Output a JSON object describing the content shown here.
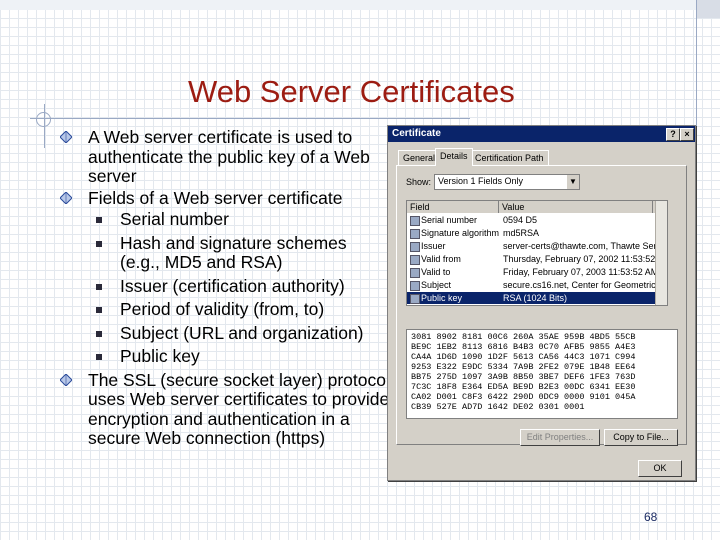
{
  "slide": {
    "title": "Web Server Certificates",
    "page_number": "68",
    "bullets": [
      {
        "text": "A Web server certificate is used to authenticate the public key of a Web server"
      },
      {
        "text": "Fields of a Web server certificate",
        "subitems": [
          "Serial number",
          "Hash and signature schemes (e.g., MD5 and RSA)",
          "Issuer (certification authority)",
          "Period of validity (from, to)",
          "Subject (URL and organization)",
          "Public key"
        ]
      },
      {
        "text": "The SSL (secure socket layer) protocol uses Web server certificates to provide encryption and authentication in a secure Web connection (https)"
      }
    ]
  },
  "dialog": {
    "title": "Certificate",
    "title_buttons": [
      "?",
      "×"
    ],
    "tabs": [
      "General",
      "Details",
      "Certification Path"
    ],
    "active_tab": "Details",
    "show_label": "Show:",
    "show_value": "Version 1 Fields Only",
    "columns": [
      "Field",
      "Value"
    ],
    "rows": [
      {
        "field": "Serial number",
        "value": "0594 D5"
      },
      {
        "field": "Signature algorithm",
        "value": "md5RSA"
      },
      {
        "field": "Issuer",
        "value": "server-certs@thawte.com, Thawte Server ..."
      },
      {
        "field": "Valid from",
        "value": "Thursday, February 07, 2002 11:53:52 AM"
      },
      {
        "field": "Valid to",
        "value": "Friday, February 07, 2003 11:53:52 AM"
      },
      {
        "field": "Subject",
        "value": "secure.cs16.net, Center for Geometric Com..."
      },
      {
        "field": "Public key",
        "value": "RSA (1024 Bits)"
      }
    ],
    "selected_row": 6,
    "hex_lines": [
      "3081 8902 8181 00C6 260A 35AE 959B 4BD5 55CB",
      "BE9C 1EB2 8113 6816 B4B3 0C70 AFB5 9855 A4E3",
      "CA4A 1D6D 1090 1D2F 5613 CA56 44C3 1071 C994",
      "9253 E322 E9DC 5334 7A9B 2FE2 079E 1B48 EE64",
      "BB75 275D 1097 3A9B 8B50 3BE7 DEF6 1FE3 763D",
      "7C3C 18F8 E364 ED5A BE9D B2E3 00DC 6341 EE30",
      "CA02 D001 C8F3 6422 290D 0DC9 0000 9101 045A",
      "CB39 527E AD7D 1642 DE02 0301 0001"
    ],
    "edit_properties_label": "Edit Properties...",
    "copy_to_file_label": "Copy to File...",
    "ok_label": "OK"
  }
}
